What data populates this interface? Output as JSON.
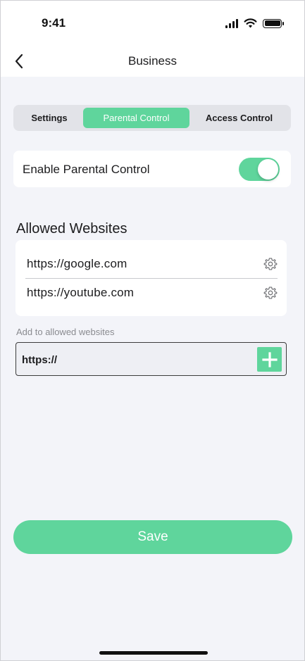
{
  "status_bar": {
    "time": "9:41"
  },
  "nav": {
    "title": "Business",
    "back_icon": "chevron-left-icon"
  },
  "tabs": [
    {
      "label": "Settings",
      "selected": false
    },
    {
      "label": "Parental Control",
      "selected": true
    },
    {
      "label": "Access Control",
      "selected": false
    }
  ],
  "parental_control": {
    "label": "Enable Parental Control",
    "enabled": true
  },
  "allowed_websites": {
    "title": "Allowed Websites",
    "items": [
      {
        "url": "https://google.com",
        "icon": "gear-icon"
      },
      {
        "url": "https://youtube.com",
        "icon": "gear-icon"
      }
    ]
  },
  "add_website": {
    "label": "Add to allowed websites",
    "value": "https://",
    "button_icon": "plus-icon"
  },
  "save_label": "Save",
  "colors": {
    "accent": "#5fd59c",
    "background": "#f3f4f9"
  }
}
